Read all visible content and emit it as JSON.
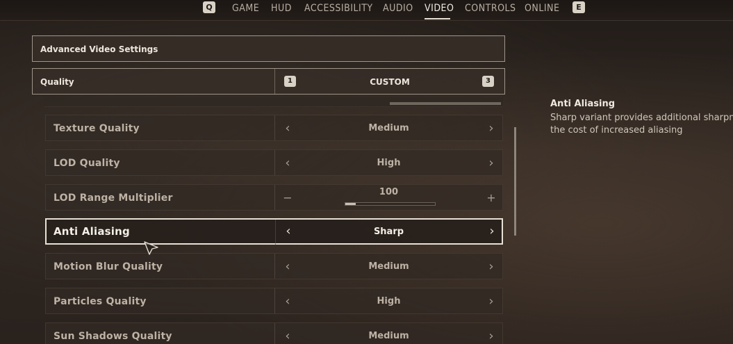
{
  "nav": {
    "left_key": "Q",
    "right_key": "E",
    "tabs": [
      "GAME",
      "HUD",
      "ACCESSIBILITY",
      "AUDIO",
      "VIDEO",
      "CONTROLS",
      "ONLINE"
    ],
    "active_tab": "VIDEO"
  },
  "section": {
    "title": "Advanced Video Settings"
  },
  "quality": {
    "label": "Quality",
    "value": "CUSTOM",
    "left_key": "1",
    "right_key": "3"
  },
  "settings": [
    {
      "label": "Texture Quality",
      "value": "Medium"
    },
    {
      "label": "LOD Quality",
      "value": "High"
    },
    {
      "label": "LOD Range Multiplier",
      "value": "100",
      "slider_fraction": 0.12
    },
    {
      "label": "Anti Aliasing",
      "value": "Sharp"
    },
    {
      "label": "Motion Blur Quality",
      "value": "Medium"
    },
    {
      "label": "Particles Quality",
      "value": "High"
    },
    {
      "label": "Sun Shadows Quality",
      "value": "Medium"
    }
  ],
  "selected_setting": "Anti Aliasing",
  "description": {
    "title": "Anti Aliasing",
    "line1": "Sharp variant provides additional sharpne",
    "line2": "the cost of increased aliasing"
  },
  "glyphs": {
    "arrow_left": "‹",
    "arrow_right": "›",
    "minus": "−",
    "plus": "+"
  },
  "colors": {
    "accent": "#e8e1d6",
    "panel": "#322a24"
  }
}
